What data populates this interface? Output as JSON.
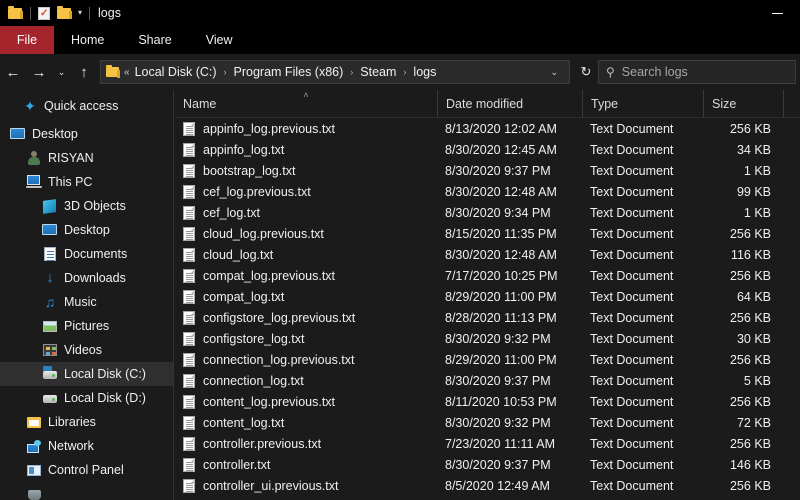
{
  "window": {
    "title": "logs",
    "quick_access": [
      {
        "icon": "folder-icon",
        "name": "new-folder-button"
      },
      {
        "icon": "properties-icon",
        "name": "properties-button"
      },
      {
        "icon": "folder-icon",
        "name": "folder-button"
      }
    ],
    "caret": "▾",
    "minimize_label": "Minimize"
  },
  "ribbon": {
    "file_label": "File",
    "file_tab_color": "#a4262c",
    "tabs": [
      "Home",
      "Share",
      "View"
    ]
  },
  "nav": {
    "back_icon": "←",
    "forward_icon": "→",
    "recent_icon": "⌄",
    "up_icon": "↑",
    "chevron_double": "«",
    "crumbs": [
      "Local Disk (C:)",
      "Program Files (x86)",
      "Steam",
      "logs"
    ],
    "crumb_sep": "›",
    "dropdown_icon": "⌄",
    "refresh_icon": "↻"
  },
  "search": {
    "icon": "🔍",
    "placeholder": "Search logs"
  },
  "sidebar": {
    "items": [
      {
        "label": "Quick access",
        "icon": "star-icon",
        "indent": 0,
        "selected": false
      },
      {
        "label": "Desktop",
        "icon": "monitor-icon",
        "indent": 0,
        "selected": false
      },
      {
        "label": "RISYAN",
        "icon": "user-icon",
        "indent": 1,
        "selected": false
      },
      {
        "label": "This PC",
        "icon": "this-pc-icon",
        "indent": 1,
        "selected": false
      },
      {
        "label": "3D Objects",
        "icon": "3d-objects-icon",
        "indent": 2,
        "selected": false
      },
      {
        "label": "Desktop",
        "icon": "monitor-icon",
        "indent": 2,
        "selected": false
      },
      {
        "label": "Documents",
        "icon": "documents-icon",
        "indent": 2,
        "selected": false
      },
      {
        "label": "Downloads",
        "icon": "downloads-icon",
        "indent": 2,
        "selected": false
      },
      {
        "label": "Music",
        "icon": "music-icon",
        "indent": 2,
        "selected": false
      },
      {
        "label": "Pictures",
        "icon": "pictures-icon",
        "indent": 2,
        "selected": false
      },
      {
        "label": "Videos",
        "icon": "videos-icon",
        "indent": 2,
        "selected": false
      },
      {
        "label": "Local Disk (C:)",
        "icon": "drive-c-icon",
        "indent": 2,
        "selected": true
      },
      {
        "label": "Local Disk (D:)",
        "icon": "drive-d-icon",
        "indent": 2,
        "selected": false
      },
      {
        "label": "Libraries",
        "icon": "libraries-icon",
        "indent": 1,
        "selected": false
      },
      {
        "label": "Network",
        "icon": "network-icon",
        "indent": 1,
        "selected": false
      },
      {
        "label": "Control Panel",
        "icon": "control-panel-icon",
        "indent": 1,
        "selected": false
      },
      {
        "label": "",
        "icon": "recycle-bin-icon",
        "indent": 1,
        "selected": false
      }
    ]
  },
  "filelist": {
    "columns": [
      {
        "label": "Name",
        "sorted": true,
        "sort_dir": "˄"
      },
      {
        "label": "Date modified",
        "sorted": false
      },
      {
        "label": "Type",
        "sorted": false
      },
      {
        "label": "Size",
        "sorted": false
      }
    ],
    "rows": [
      {
        "name": "appinfo_log.previous.txt",
        "date": "8/13/2020 12:02 AM",
        "type": "Text Document",
        "size": "256 KB"
      },
      {
        "name": "appinfo_log.txt",
        "date": "8/30/2020 12:45 AM",
        "type": "Text Document",
        "size": "34 KB"
      },
      {
        "name": "bootstrap_log.txt",
        "date": "8/30/2020 9:37 PM",
        "type": "Text Document",
        "size": "1 KB"
      },
      {
        "name": "cef_log.previous.txt",
        "date": "8/30/2020 12:48 AM",
        "type": "Text Document",
        "size": "99 KB"
      },
      {
        "name": "cef_log.txt",
        "date": "8/30/2020 9:34 PM",
        "type": "Text Document",
        "size": "1 KB"
      },
      {
        "name": "cloud_log.previous.txt",
        "date": "8/15/2020 11:35 PM",
        "type": "Text Document",
        "size": "256 KB"
      },
      {
        "name": "cloud_log.txt",
        "date": "8/30/2020 12:48 AM",
        "type": "Text Document",
        "size": "116 KB"
      },
      {
        "name": "compat_log.previous.txt",
        "date": "7/17/2020 10:25 PM",
        "type": "Text Document",
        "size": "256 KB"
      },
      {
        "name": "compat_log.txt",
        "date": "8/29/2020 11:00 PM",
        "type": "Text Document",
        "size": "64 KB"
      },
      {
        "name": "configstore_log.previous.txt",
        "date": "8/28/2020 11:13 PM",
        "type": "Text Document",
        "size": "256 KB"
      },
      {
        "name": "configstore_log.txt",
        "date": "8/30/2020 9:32 PM",
        "type": "Text Document",
        "size": "30 KB"
      },
      {
        "name": "connection_log.previous.txt",
        "date": "8/29/2020 11:00 PM",
        "type": "Text Document",
        "size": "256 KB"
      },
      {
        "name": "connection_log.txt",
        "date": "8/30/2020 9:37 PM",
        "type": "Text Document",
        "size": "5 KB"
      },
      {
        "name": "content_log.previous.txt",
        "date": "8/11/2020 10:53 PM",
        "type": "Text Document",
        "size": "256 KB"
      },
      {
        "name": "content_log.txt",
        "date": "8/30/2020 9:32 PM",
        "type": "Text Document",
        "size": "72 KB"
      },
      {
        "name": "controller.previous.txt",
        "date": "7/23/2020 11:11 AM",
        "type": "Text Document",
        "size": "256 KB"
      },
      {
        "name": "controller.txt",
        "date": "8/30/2020 9:37 PM",
        "type": "Text Document",
        "size": "146 KB"
      },
      {
        "name": "controller_ui.previous.txt",
        "date": "8/5/2020 12:49 AM",
        "type": "Text Document",
        "size": "256 KB"
      }
    ]
  }
}
